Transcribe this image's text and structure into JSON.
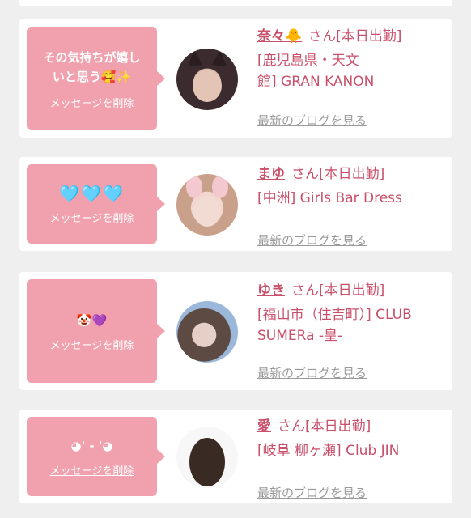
{
  "cards": [
    {
      "message_lines": [
        "その気持ちが嬉し",
        "いと思う🥰✨"
      ],
      "delete_label": "メッセージを削除",
      "name": "奈々🐥",
      "suffix": "さん[本日出勤]",
      "shop_lines": [
        "[鹿児島県・天文",
        "館] GRAN KANON"
      ],
      "blog_label": "最新のブログを見る",
      "avatar_colors": [
        "#3b2b2e",
        "#d8b7a8"
      ]
    },
    {
      "message_lines": [
        "🩵🩵🩵"
      ],
      "delete_label": "メッセージを削除",
      "name": "まゆ",
      "suffix": "さん[本日出勤]",
      "shop_lines": [
        "[中洲] Girls Bar Dress"
      ],
      "blog_label": "最新のブログを見る",
      "avatar_colors": [
        "#f2cfc9",
        "#c9a08a"
      ]
    },
    {
      "message_lines": [
        "🤡💜"
      ],
      "delete_label": "メッセージを削除",
      "name": "ゆき",
      "suffix": "さん[本日出勤]",
      "shop_lines": [
        "[福山市（住吉町）] CLUB",
        "SUMERa -皇-"
      ],
      "blog_label": "最新のブログを見る",
      "avatar_colors": [
        "#9bb7d9",
        "#5c4a43"
      ]
    },
    {
      "message_lines": [
        "◕' - '◕"
      ],
      "delete_label": "メッセージを削除",
      "name": "愛",
      "suffix": "さん[本日出勤]",
      "shop_lines": [
        "[岐阜 柳ヶ瀬] Club JIN"
      ],
      "blog_label": "最新のブログを見る",
      "avatar_colors": [
        "#f7f7f7",
        "#3a2a24"
      ]
    }
  ]
}
